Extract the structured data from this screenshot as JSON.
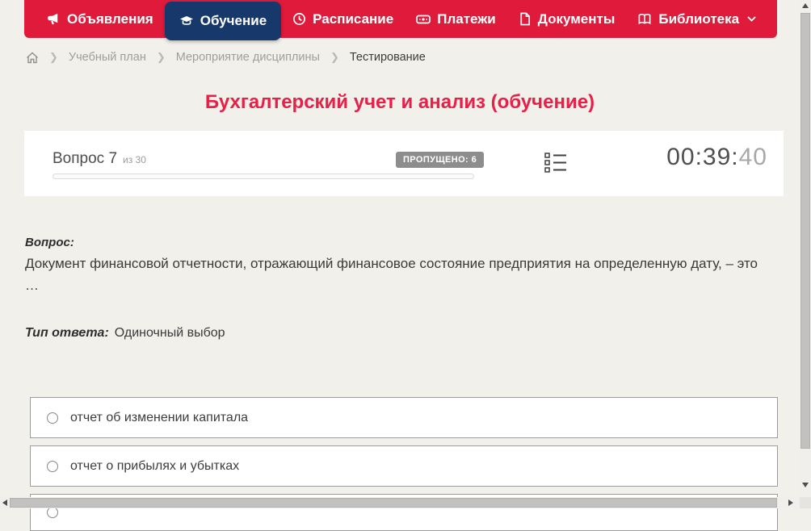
{
  "nav": {
    "items": [
      {
        "label": "Объявления",
        "icon": "megaphone-icon",
        "active": false
      },
      {
        "label": "Обучение",
        "icon": "graduation-cap-icon",
        "active": true
      },
      {
        "label": "Расписание",
        "icon": "clock-icon",
        "active": false
      },
      {
        "label": "Платежи",
        "icon": "payments-icon",
        "active": false
      },
      {
        "label": "Документы",
        "icon": "document-icon",
        "active": false
      },
      {
        "label": "Библиотека",
        "icon": "library-icon",
        "active": false,
        "has_dropdown": true
      }
    ]
  },
  "breadcrumb": {
    "items": [
      "Учебный план",
      "Мероприятие дисциплины",
      "Тестирование"
    ]
  },
  "page": {
    "title": "Бухгалтерский учет и анализ (обучение)"
  },
  "quiz_header": {
    "question_label": "Вопрос 7",
    "question_of": "из 30",
    "skipped_badge": "ПРОПУЩЕНО: 6",
    "timer_main": "00:39:",
    "timer_seconds": "40",
    "progress_percent": 0
  },
  "question": {
    "heading": "Вопрос:",
    "lines": [
      "Документ финансовой отчетности, отражающий финансовое состояние предприятия на определенную дату, – это",
      "…"
    ],
    "answer_type_label": "Тип ответа:",
    "answer_type_value": "Одиночный выбор"
  },
  "options": [
    {
      "label": "отчет об изменении капитала"
    },
    {
      "label": "отчет о прибылях и убытках"
    },
    {
      "label": ""
    }
  ],
  "colors": {
    "nav_red": "#df1a3b",
    "active_navy": "#17386b",
    "title_red": "#e72048",
    "page_bg": "#f2f0ea",
    "badge_gray": "#8d8d8d",
    "text_dark": "#3a3a3a"
  }
}
